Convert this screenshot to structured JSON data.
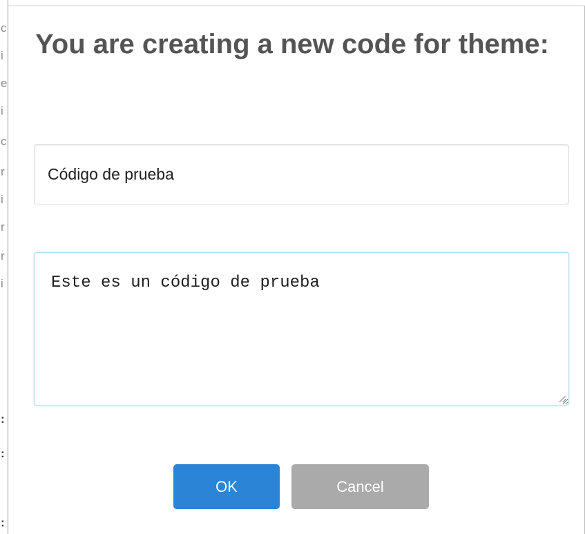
{
  "dialog": {
    "title": "You are creating a new code for theme:",
    "name_field": {
      "value": "Código de prueba",
      "placeholder": ""
    },
    "description_field": {
      "value": "Este es un código de prueba",
      "placeholder": ""
    },
    "buttons": {
      "ok_label": "OK",
      "cancel_label": "Cancel"
    }
  },
  "colors": {
    "ok_button": "#2b84d6",
    "cancel_button": "#aaaaaa",
    "title_text": "#545454",
    "focus_border": "#b4dbed"
  },
  "icons": {
    "resize_handle": "resize-grip-icon"
  }
}
